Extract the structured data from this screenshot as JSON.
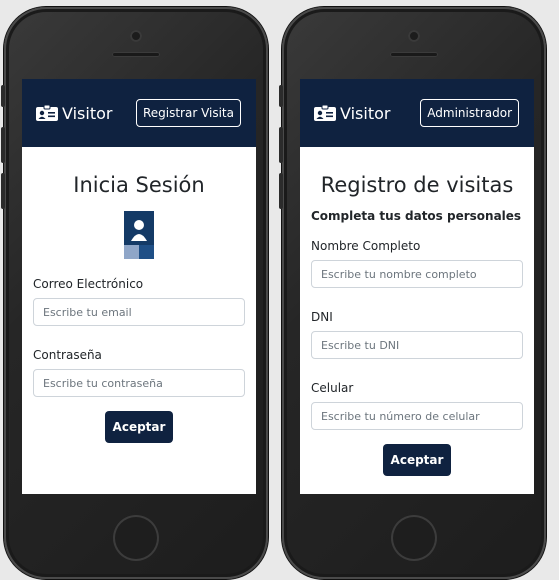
{
  "brand": {
    "name": "Visitor",
    "icon": "id-badge-icon"
  },
  "colors": {
    "navbar": "#0f2240",
    "button": "#0f2240",
    "text": "#212529",
    "placeholder": "#6c757d"
  },
  "login": {
    "nav_button": "Registrar Visita",
    "title": "Inicia Sesión",
    "email_label": "Correo Electrónico",
    "email_placeholder": "Escribe tu email",
    "password_label": "Contraseña",
    "password_placeholder": "Escribe tu contraseña",
    "submit": "Aceptar"
  },
  "register": {
    "nav_button": "Administrador",
    "title": "Registro de visitas",
    "subtitle": "Completa tus datos personales",
    "name_label": "Nombre Completo",
    "name_placeholder": "Escribe tu nombre completo",
    "dni_label": "DNI",
    "dni_placeholder": "Escribe tu DNI",
    "phone_label": "Celular",
    "phone_placeholder": "Escribe tu número de celular",
    "submit": "Aceptar"
  }
}
